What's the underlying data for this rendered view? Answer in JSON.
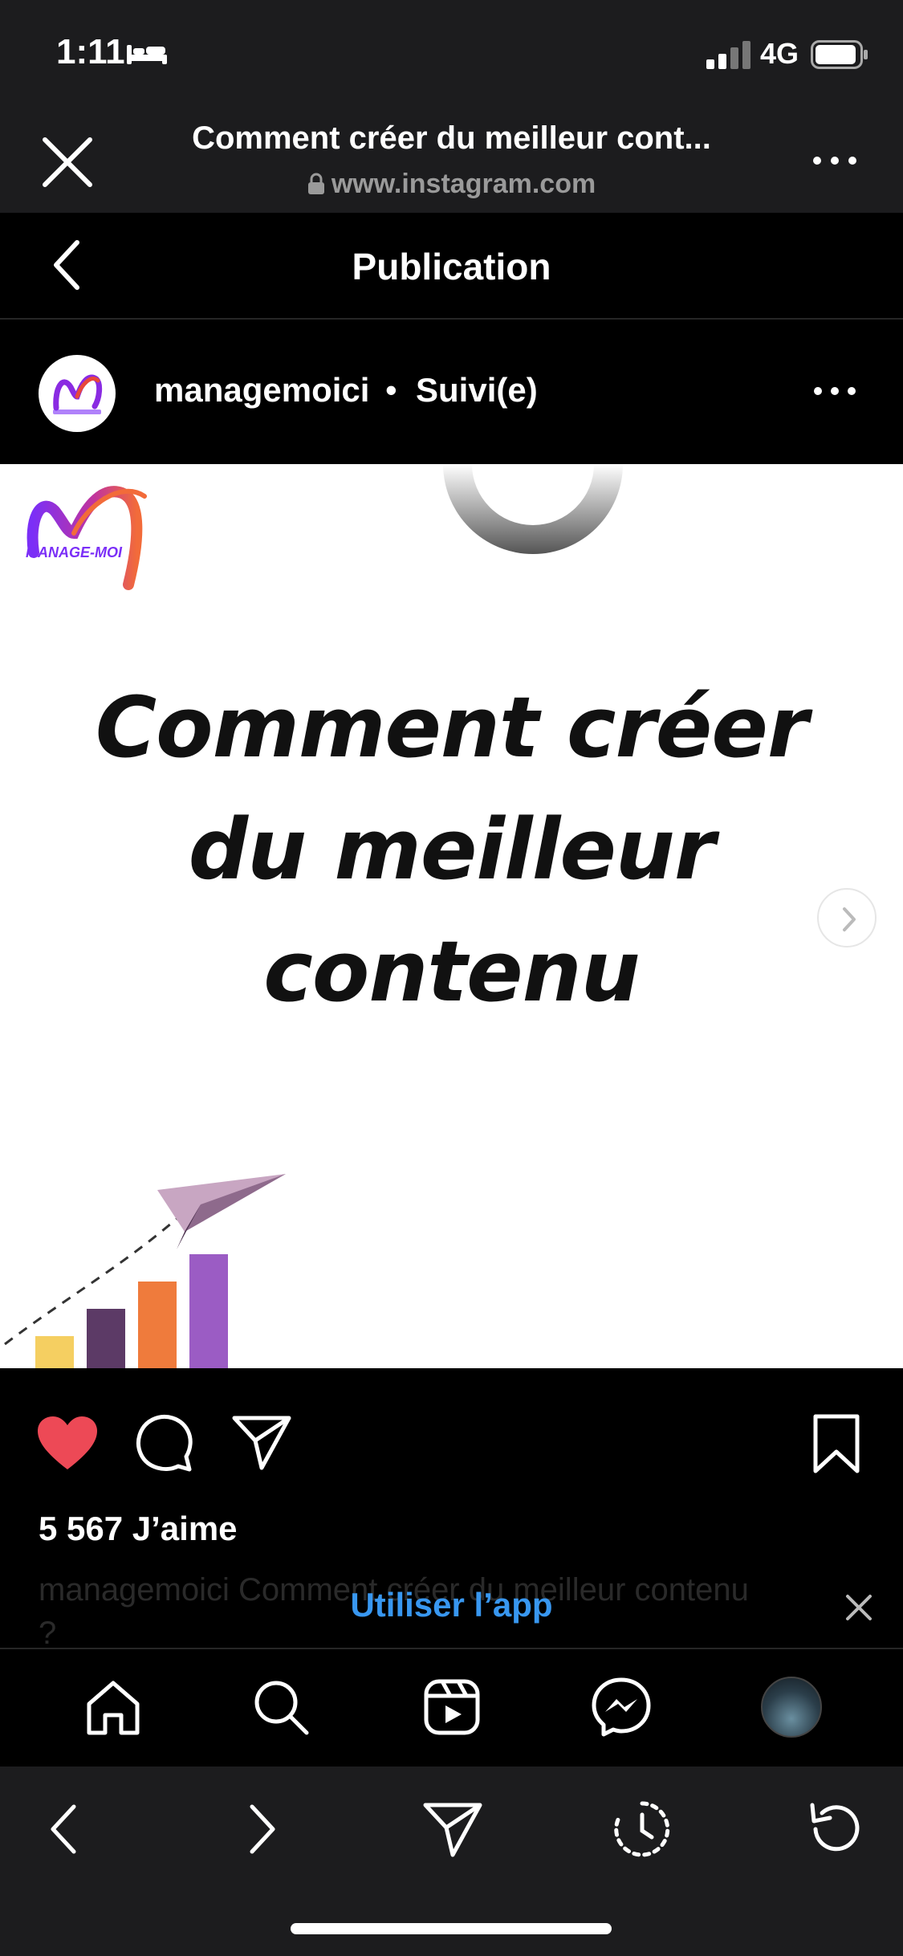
{
  "status_bar": {
    "time": "1:11",
    "network": "4G",
    "icons": [
      "bed-icon",
      "signal-icon",
      "battery-icon"
    ]
  },
  "browser": {
    "page_title": "Comment créer du meilleur cont...",
    "url": "www.instagram.com",
    "icons": [
      "close-icon",
      "lock-icon",
      "more-icon"
    ]
  },
  "ig_nav": {
    "title": "Publication",
    "icons": [
      "back-icon"
    ]
  },
  "post": {
    "username": "managemoici",
    "separator": "•",
    "follow_state": "Suivi(e)",
    "image": {
      "logo_text": "MANAGE-MOI",
      "headline_lines": [
        "Comment créer",
        "du meilleur",
        "contenu"
      ],
      "colors": {
        "logo_purple": "#7b2ff7",
        "logo_orange": "#f26b3a",
        "bar_yellow": "#f5cf61",
        "bar_plum": "#5c3a66",
        "bar_orange": "#ef7b3c",
        "bar_violet": "#9b5cc4"
      }
    },
    "likes": "5 567 J’aime",
    "caption": "managemoici Comment créer du meilleur contenu",
    "caption_more": "?",
    "liked_color": "#ed4956"
  },
  "banner": {
    "label": "Utiliser l’app",
    "color": "#3897f0"
  },
  "tabs": [
    "home-icon",
    "search-icon",
    "reels-icon",
    "messenger-icon",
    "profile-avatar"
  ],
  "toolbar": [
    "back-icon",
    "forward-icon",
    "share-icon",
    "history-icon",
    "reload-icon"
  ]
}
